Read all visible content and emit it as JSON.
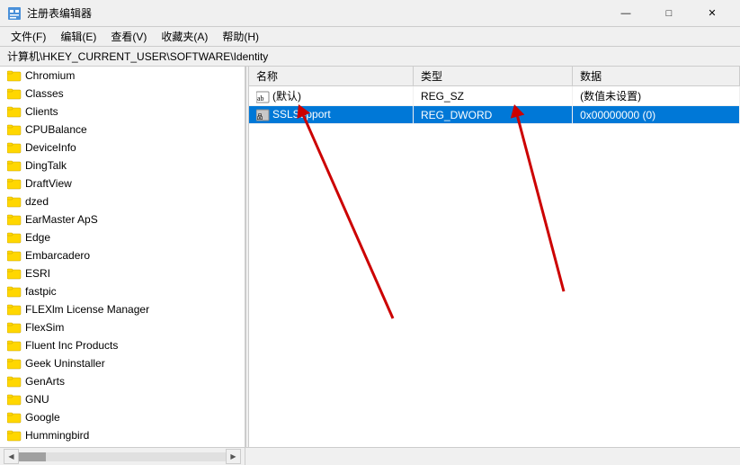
{
  "window": {
    "title": "注册表编辑器",
    "minimize_label": "—",
    "maximize_label": "□",
    "close_label": "✕"
  },
  "menubar": {
    "items": [
      {
        "label": "文件(F)"
      },
      {
        "label": "编辑(E)"
      },
      {
        "label": "查看(V)"
      },
      {
        "label": "收藏夹(A)"
      },
      {
        "label": "帮助(H)"
      }
    ]
  },
  "address": {
    "label": "计算机\\HKEY_CURRENT_USER\\SOFTWARE\\Identity"
  },
  "tree": {
    "items": [
      {
        "label": "Chromium",
        "indent": 0
      },
      {
        "label": "Classes",
        "indent": 0
      },
      {
        "label": "Clients",
        "indent": 0
      },
      {
        "label": "CPUBalance",
        "indent": 0
      },
      {
        "label": "DeviceInfo",
        "indent": 0
      },
      {
        "label": "DingTalk",
        "indent": 0
      },
      {
        "label": "DraftView",
        "indent": 0
      },
      {
        "label": "dzed",
        "indent": 0
      },
      {
        "label": "EarMaster ApS",
        "indent": 0
      },
      {
        "label": "Edge",
        "indent": 0
      },
      {
        "label": "Embarcadero",
        "indent": 0
      },
      {
        "label": "ESRI",
        "indent": 0
      },
      {
        "label": "fastpic",
        "indent": 0
      },
      {
        "label": "FLEXlm License Manager",
        "indent": 0
      },
      {
        "label": "FlexSim",
        "indent": 0
      },
      {
        "label": "Fluent Inc Products",
        "indent": 0
      },
      {
        "label": "Geek Uninstaller",
        "indent": 0
      },
      {
        "label": "GenArts",
        "indent": 0
      },
      {
        "label": "GNU",
        "indent": 0
      },
      {
        "label": "Google",
        "indent": 0
      },
      {
        "label": "Hummingbird",
        "indent": 0
      }
    ]
  },
  "registry_table": {
    "columns": [
      "名称",
      "类型",
      "数据"
    ],
    "rows": [
      {
        "name": "(默认)",
        "type": "REG_SZ",
        "data": "(数值未设置)",
        "icon_type": "ab",
        "selected": false
      },
      {
        "name": "SSLSupport",
        "type": "REG_DWORD",
        "data": "0x00000000 (0)",
        "icon_type": "dword",
        "selected": true
      }
    ]
  },
  "arrows": {
    "color": "#cc0000"
  }
}
